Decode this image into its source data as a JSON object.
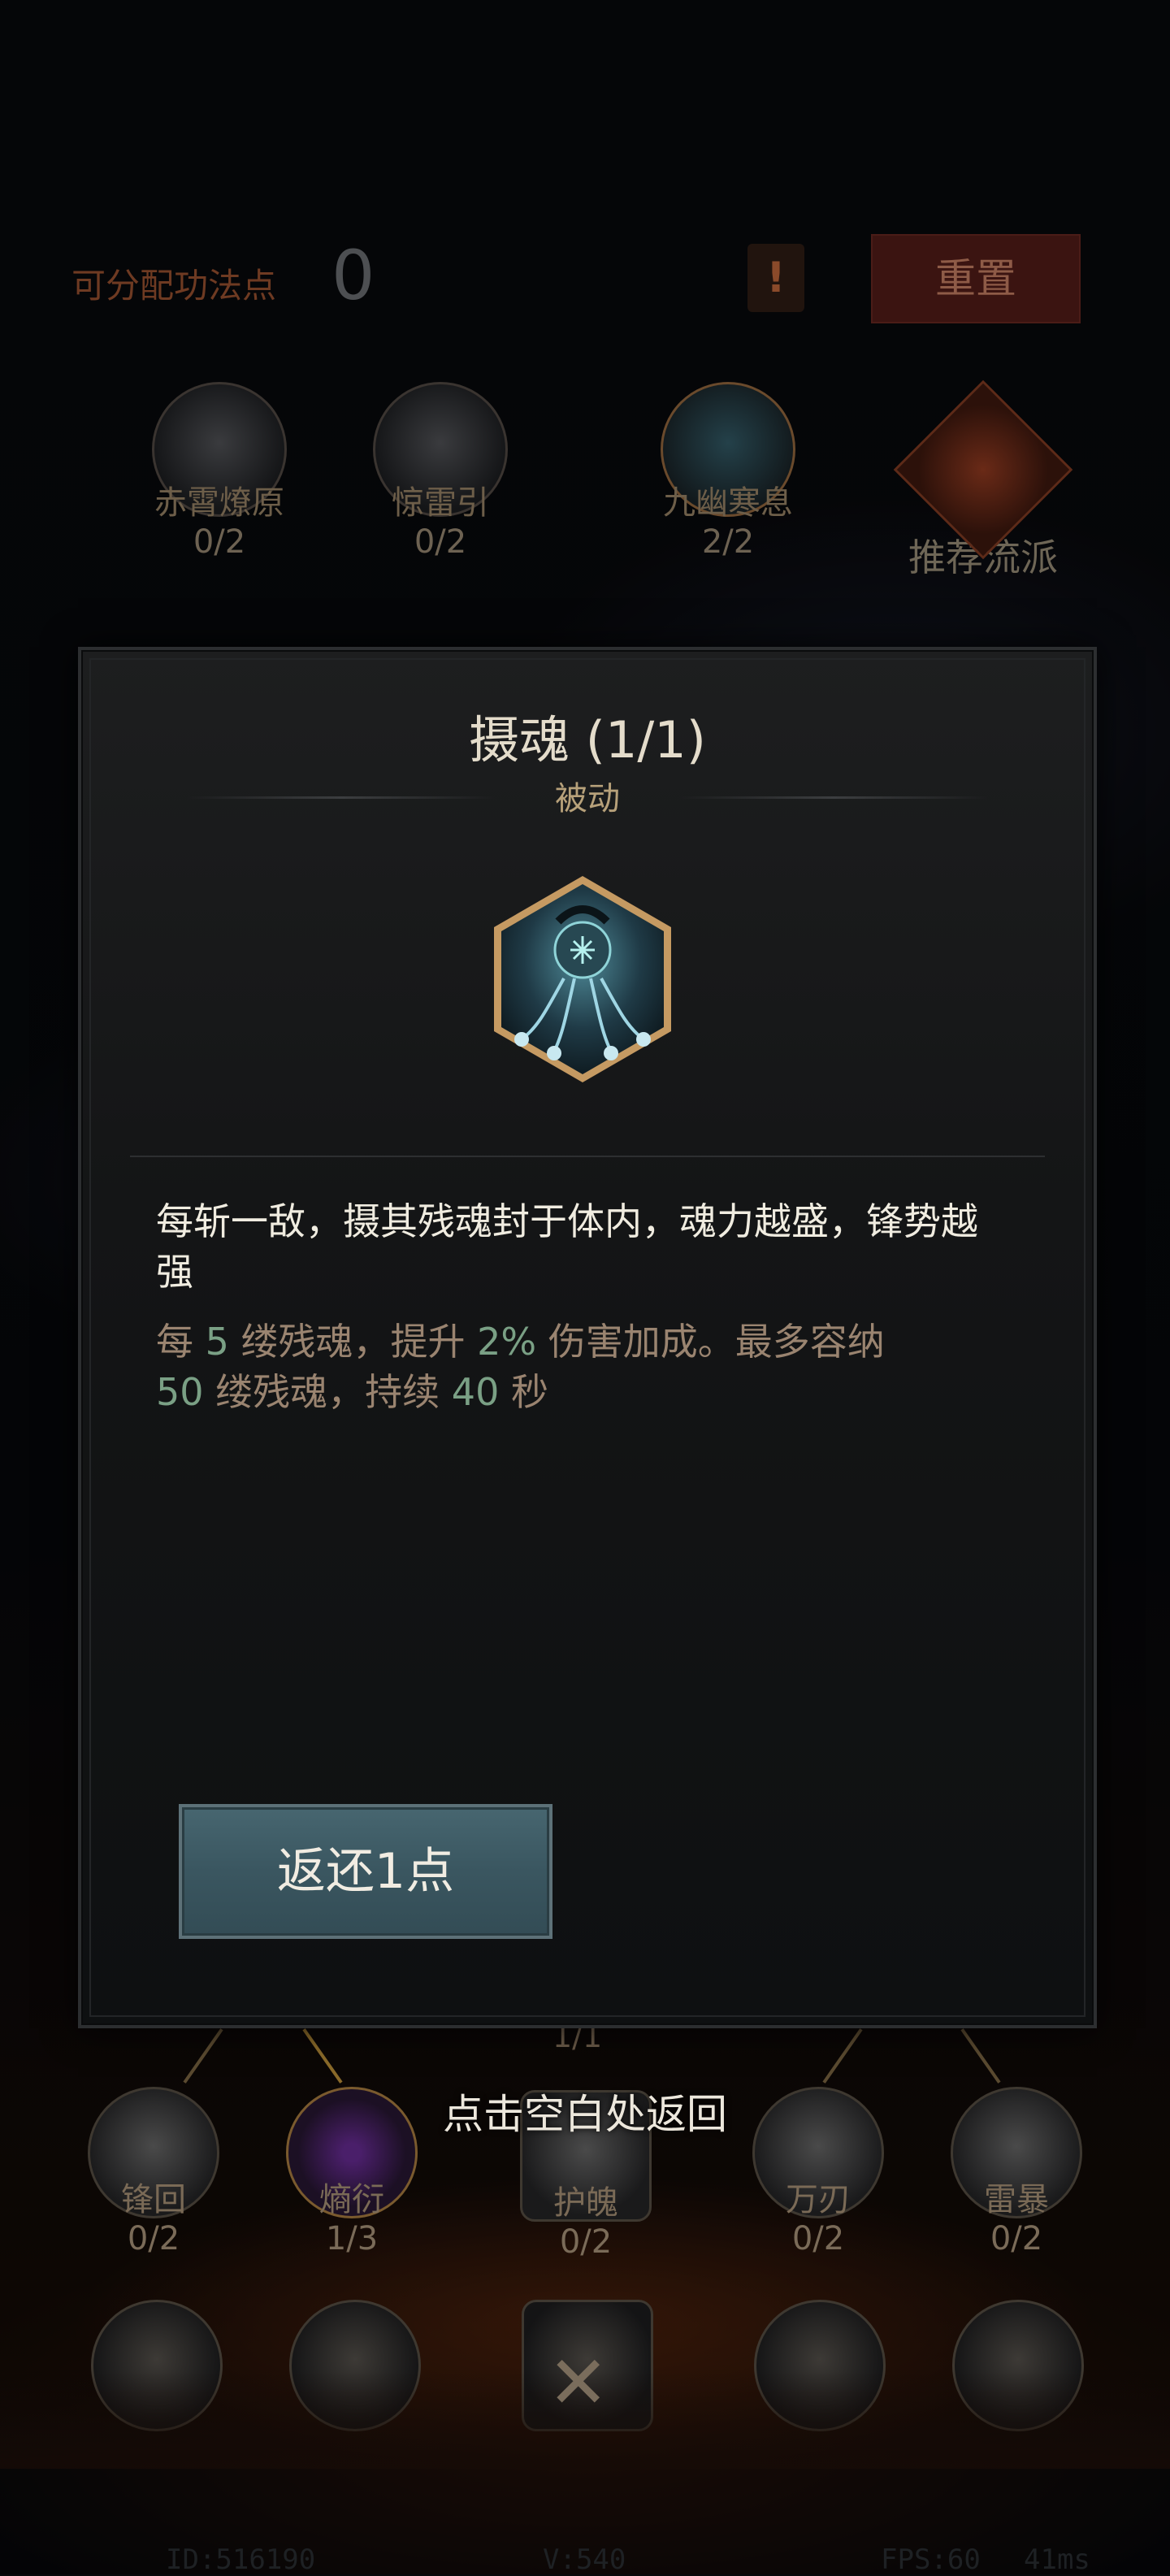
{
  "top_bar": {
    "points_label": "可分配功法点",
    "points_value": "0",
    "warning_label": "!",
    "reset_label": "重置"
  },
  "schools": [
    {
      "name": "赤霄燎原",
      "value": "0/2"
    },
    {
      "name": "惊雷引",
      "value": "0/2"
    },
    {
      "name": "九幽寒息",
      "value": "2/2"
    }
  ],
  "recommend_label": "推荐流派",
  "modal": {
    "title": "摄魂 (1/1)",
    "subtitle": "被动",
    "skill_icon": "soul-capture-icon",
    "description": "每斩一敌，摄其残魂封于体内，魂力越盛，锋势越强",
    "detail_parts": {
      "p1": "每 ",
      "n1": "5",
      "p2": " 缕残魂，提升 ",
      "n2": "2%",
      "p3": " 伤害加成。最多容纳 ",
      "n3": "50",
      "p4": " 缕残魂，持续 ",
      "n4": "40",
      "p5": " 秒"
    },
    "return_button": "返还1点"
  },
  "hint": "点击空白处返回",
  "tree_partial_label": "1/1",
  "skill_nodes": [
    {
      "name": "锋回",
      "value": "0/2"
    },
    {
      "name": "熵衍",
      "value": "1/3"
    },
    {
      "name": "护魄",
      "value": "0/2"
    },
    {
      "name": "万刃",
      "value": "0/2"
    },
    {
      "name": "雷暴",
      "value": "0/2"
    }
  ],
  "status_bar": {
    "id": "ID:516190",
    "version": "V:540",
    "fps": "FPS:60",
    "latency": "41ms"
  },
  "colors": {
    "accent_gold": "#b7a17a",
    "highlight_green": "#7aa085",
    "button_teal": "#3a5660",
    "reset_red": "#3b1411"
  }
}
